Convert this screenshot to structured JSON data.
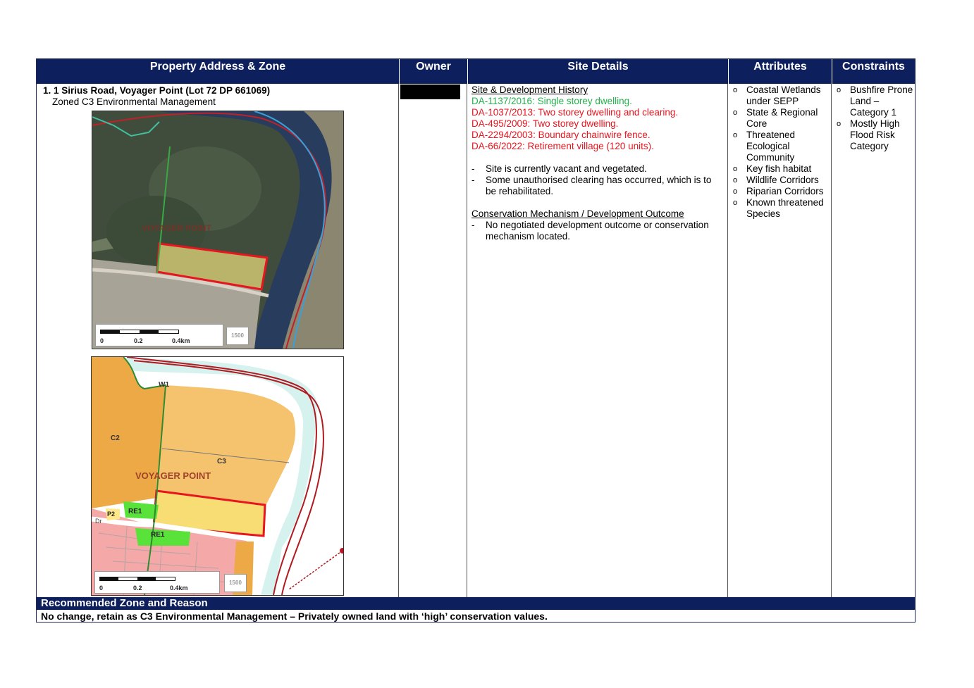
{
  "headers": {
    "address": "Property Address & Zone",
    "owner": "Owner",
    "site": "Site Details",
    "attributes": "Attributes",
    "constraints": "Constraints"
  },
  "property": {
    "address_line": "1. 1 Sirius Road, Voyager Point (Lot 72 DP 661069)",
    "zone_line": "Zoned C3 Environmental Management"
  },
  "aerial_map": {
    "suburb_label": "VOYAGER POINT",
    "scale_labels": [
      "0",
      "0.2",
      "0.4km"
    ],
    "scale_badge": "1500"
  },
  "zoning_map": {
    "labels": {
      "w1": "W1",
      "c2": "C2",
      "c3": "C3",
      "suburb": "VOYAGER POINT",
      "re1_top": "RE1",
      "re1_bottom": "RE1",
      "p2": "P2",
      "dr": "Dr"
    },
    "scale_labels": [
      "0",
      "0.2",
      "0.4km"
    ],
    "scale_badge": "1500",
    "colors": {
      "c2": "#eda945",
      "c3": "#f5c36e",
      "w1": "#d6f2ee",
      "re1": "#58e23a",
      "residential": "#f4a8a8",
      "subject": "#f8dc74"
    }
  },
  "site_details": {
    "history_heading": "Site & Development History",
    "history": [
      {
        "text": "DA-1137/2016: Single storey dwelling.",
        "color": "#22b14c"
      },
      {
        "text": "DA-1037/2013: Two storey dwelling and clearing.",
        "color": "#e8141e"
      },
      {
        "text": "DA-495/2009: Two storey dwelling.",
        "color": "#e8141e"
      },
      {
        "text": "DA-2294/2003: Boundary chainwire fence.",
        "color": "#e8141e"
      },
      {
        "text": "DA-66/2022: Retirement village (120 units).",
        "color": "#e8141e"
      }
    ],
    "notes": [
      "Site is currently vacant and vegetated.",
      "Some unauthorised clearing has occurred, which is to be rehabilitated."
    ],
    "conservation_heading": "Conservation Mechanism / Development Outcome",
    "conservation": [
      "No negotiated development outcome or conservation mechanism located."
    ]
  },
  "attributes": [
    "Coastal Wetlands under SEPP",
    "State & Regional Core",
    "Threatened Ecological Community",
    "Key fish habitat",
    "Wildlife Corridors",
    "Riparian Corridors",
    "Known threatened Species"
  ],
  "constraints": [
    "Bushfire Prone Land – Category 1",
    "Mostly High Flood Risk Category"
  ],
  "recommendation": {
    "heading": "Recommended Zone and Reason",
    "text": "No change, retain as C3 Environmental Management – Privately owned land with ‘high’ conservation values."
  }
}
